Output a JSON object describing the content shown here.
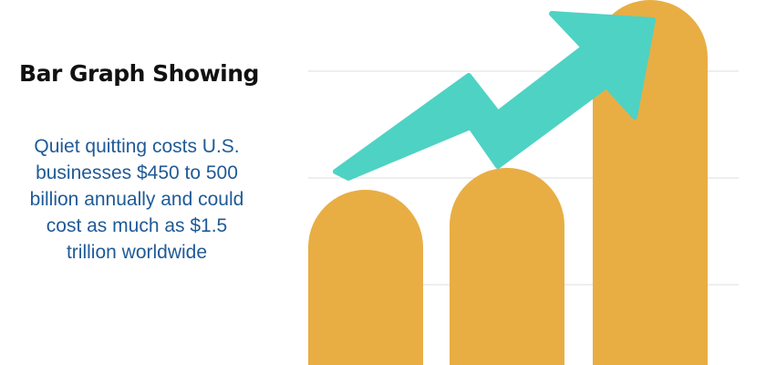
{
  "heading": "Bar Graph Showing",
  "description_lines": [
    "Quiet quitting costs U.S.",
    "businesses $450 to 500",
    "billion annually and could",
    "cost as much as $1.5",
    "trillion worldwide"
  ],
  "colors": {
    "bar": "#e8ae44",
    "arrow": "#4ed2c4",
    "grid": "#dddddd",
    "title": "#111111",
    "description": "#1f5a96"
  },
  "chart_data": {
    "type": "bar",
    "categories": [
      "",
      "",
      ""
    ],
    "values": [
      0.48,
      0.54,
      1.0
    ],
    "ylim": [
      0,
      1
    ],
    "grid": true,
    "legend": "none",
    "trend_arrow": {
      "direction": "up-right",
      "points": [
        0.38,
        0.6,
        0.52,
        0.88
      ]
    }
  }
}
